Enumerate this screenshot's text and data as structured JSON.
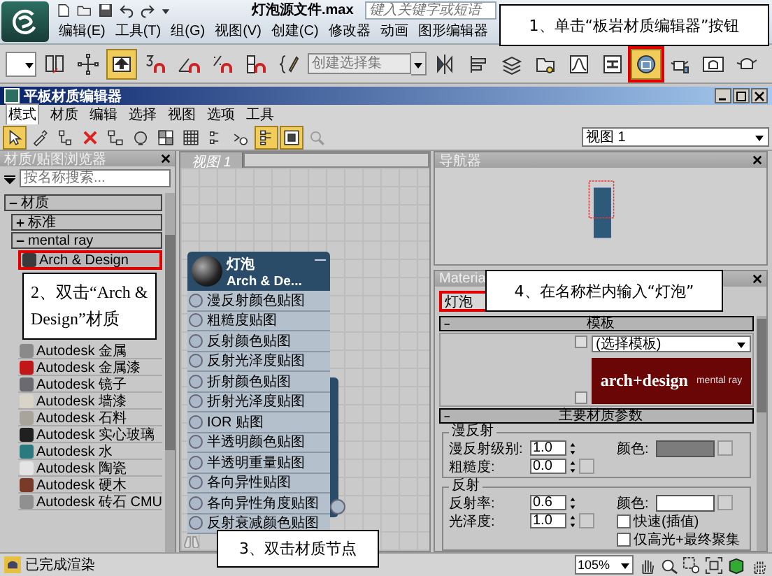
{
  "app": {
    "title": "灯泡源文件.max",
    "search": {
      "placeholder": "键入关键字或短语"
    },
    "menu": [
      "编辑(E)",
      "工具(T)",
      "组(G)",
      "视图(V)",
      "创建(C)",
      "修改器",
      "动画",
      "图形编辑器"
    ]
  },
  "main_toolbar": {
    "tools_left": [
      {
        "kind": "link",
        "selected": false,
        "marked": false
      },
      {
        "kind": "gizmo",
        "selected": false,
        "marked": false
      },
      {
        "kind": "select",
        "selected": true,
        "marked": false
      },
      {
        "kind": "snap3",
        "selected": false,
        "marked": false
      },
      {
        "kind": "angle",
        "selected": false,
        "marked": false
      },
      {
        "kind": "percent",
        "selected": false,
        "marked": false
      },
      {
        "kind": "spinner",
        "selected": false,
        "marked": false
      },
      {
        "kind": "named-sets",
        "selected": false,
        "marked": false
      }
    ],
    "selection_set": {
      "placeholder": "创建选择集"
    },
    "tools_right": [
      {
        "kind": "mirror",
        "selected": false,
        "marked": false
      },
      {
        "kind": "align",
        "selected": false,
        "marked": false
      },
      {
        "kind": "layers",
        "selected": false,
        "marked": false
      },
      {
        "kind": "explorer",
        "selected": false,
        "marked": false
      },
      {
        "kind": "curve",
        "selected": false,
        "marked": false
      },
      {
        "kind": "schematic",
        "selected": false,
        "marked": false
      },
      {
        "kind": "slate",
        "selected": true,
        "marked": true
      },
      {
        "kind": "render-setup",
        "selected": false,
        "marked": false
      },
      {
        "kind": "frame",
        "selected": false,
        "marked": false
      },
      {
        "kind": "teapot",
        "selected": false,
        "marked": false
      }
    ]
  },
  "slate_editor": {
    "title": "平板材质编辑器",
    "menu": [
      {
        "label": "模式",
        "selected": true
      },
      {
        "label": "材质",
        "selected": false
      },
      {
        "label": "编辑",
        "selected": false
      },
      {
        "label": "选择",
        "selected": false
      },
      {
        "label": "视图",
        "selected": false
      },
      {
        "label": "选项",
        "selected": false
      },
      {
        "label": "工具",
        "selected": false
      }
    ],
    "toolbar": [
      {
        "kind": "pointer",
        "selected": true
      },
      {
        "kind": "eyedropper",
        "selected": false
      },
      {
        "kind": "assign",
        "selected": false
      },
      {
        "kind": "delete",
        "selected": false
      },
      {
        "kind": "move-children",
        "selected": false
      },
      {
        "kind": "bulb",
        "selected": false
      },
      {
        "kind": "background",
        "selected": false
      },
      {
        "kind": "checker",
        "selected": false
      },
      {
        "kind": "tree-nodes",
        "selected": false
      },
      {
        "kind": "link-out",
        "selected": false
      },
      {
        "kind": "layout",
        "selected": true
      },
      {
        "kind": "hide",
        "selected": true
      },
      {
        "kind": "search",
        "selected": false
      }
    ],
    "view_selector": "视图 1",
    "browser": {
      "title": "材质/贴图浏览器",
      "search": {
        "placeholder": "按名称搜索..."
      },
      "tree": [
        {
          "label": "材质",
          "expanded": true,
          "children": [
            {
              "label": "标准",
              "expanded": false
            },
            {
              "label": "mental ray",
              "expanded": true,
              "children": [
                {
                  "label": "Arch & Design",
                  "color": "#3a3a3a",
                  "selected": true
                },
                {
                  "label": "Autodesk 金属",
                  "color": "#8a8a8a",
                  "selected": false
                },
                {
                  "label": "Autodesk 金属漆",
                  "color": "#c01818",
                  "selected": false
                },
                {
                  "label": "Autodesk 镜子",
                  "color": "#6a6a70",
                  "selected": false
                },
                {
                  "label": "Autodesk 墙漆",
                  "color": "#d8d4c8",
                  "selected": false
                },
                {
                  "label": "Autodesk 石料",
                  "color": "#a8a49c",
                  "selected": false
                },
                {
                  "label": "Autodesk 实心玻璃",
                  "color": "#202020",
                  "selected": false
                },
                {
                  "label": "Autodesk 水",
                  "color": "#2a7a80",
                  "selected": false
                },
                {
                  "label": "Autodesk 陶瓷",
                  "color": "#e4e4e4",
                  "selected": false
                },
                {
                  "label": "Autodesk 硬木",
                  "color": "#7a3a28",
                  "selected": false
                },
                {
                  "label": "Autodesk 砖石 CMU",
                  "color": "#909090",
                  "selected": false
                }
              ]
            }
          ]
        }
      ]
    },
    "view": {
      "tab": "视图 1",
      "node": {
        "name": "灯泡",
        "type": "Arch & De...",
        "slots": [
          "漫反射颜色贴图",
          "粗糙度贴图",
          "反射颜色贴图",
          "反射光泽度贴图",
          "折射颜色贴图",
          "折射光泽度贴图",
          "IOR 贴图",
          "半透明颜色贴图",
          "半透明重量贴图",
          "各向异性贴图",
          "各向异性角度贴图",
          "反射衰减颜色贴图"
        ]
      }
    },
    "navigator": {
      "title": "导航器"
    },
    "material_panel": {
      "title": "Materia",
      "name": {
        "value": "灯泡",
        "marked": true
      },
      "templates": {
        "title": "模板",
        "value": "(选择模板)",
        "banner": "arch+design",
        "banner_sub": "mental ray"
      },
      "main_params": {
        "title": "主要材质参数",
        "groups": [
          {
            "title": "漫反射",
            "rows": [
              {
                "kind": "spinner",
                "label": "漫反射级别:",
                "value": "1.0"
              },
              {
                "kind": "spinner-map",
                "label": "粗糙度:",
                "value": "0.0"
              }
            ],
            "swatch": {
              "label": "颜色:",
              "color": "#7c7c7c"
            }
          },
          {
            "title": "反射",
            "rows": [
              {
                "kind": "spinner",
                "label": "反射率:",
                "value": "0.6"
              },
              {
                "kind": "spinner-map",
                "label": "光泽度:",
                "value": "1.0"
              }
            ],
            "swatch": {
              "label": "颜色:",
              "color": "#ffffff"
            },
            "checks": [
              {
                "label": "快速(插值)",
                "checked": false
              },
              {
                "label": "仅高光+最终聚集",
                "checked": false
              }
            ]
          }
        ]
      }
    },
    "status": "已完成渲染",
    "zoom": "105%"
  },
  "callouts": [
    {
      "kind": "toolbar",
      "text": "1、单击“板岩材质编辑器”按钮"
    },
    {
      "kind": "browser",
      "text": "2、双击“Arch & Design”材质"
    },
    {
      "kind": "node",
      "text": "3、双击材质节点"
    },
    {
      "kind": "name",
      "text": "4、在名称栏内输入“灯泡”"
    }
  ]
}
